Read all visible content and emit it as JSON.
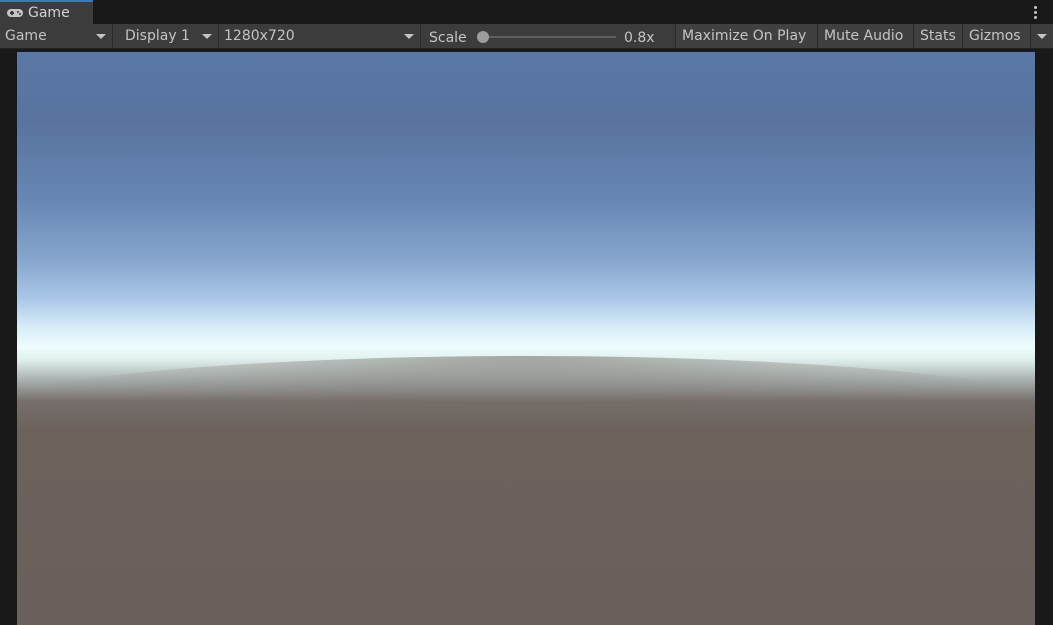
{
  "window": {
    "tab_label": "Game",
    "tab_icon": "gamepad-icon",
    "menu_icon": "kebab-menu-icon"
  },
  "toolbar": {
    "view_mode": "Game",
    "display": "Display 1",
    "resolution": "1280x720",
    "scale_label": "Scale",
    "scale_value": "0.8x",
    "scale_fraction": 0.0,
    "maximize_label": "Maximize On Play",
    "mute_label": "Mute Audio",
    "stats_label": "Stats",
    "gizmos_label": "Gizmos"
  },
  "colors": {
    "panel_bg": "#3c3c3c",
    "frame_bg": "#191919",
    "sky_top": "#5a78a6",
    "horizon": "#effcfd",
    "ground": "#6a605b"
  }
}
